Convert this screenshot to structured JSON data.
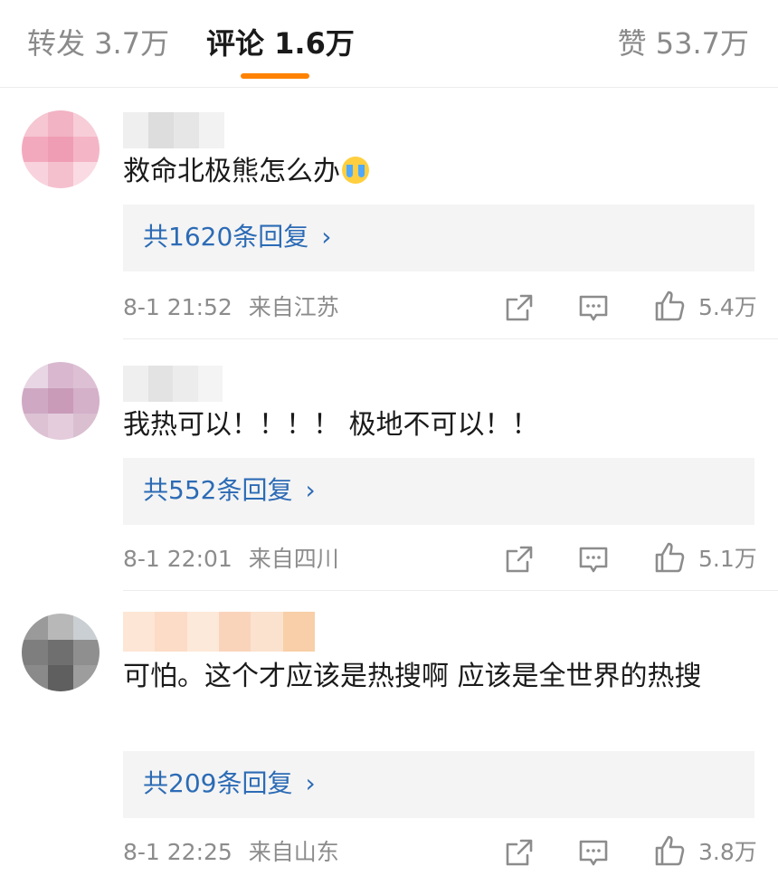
{
  "tabs": {
    "repost": "转发 3.7万",
    "comments": "评论 1.6万",
    "likes": "赞 53.7万"
  },
  "colors": {
    "accent": "#ff8200",
    "link": "#2c6bb5",
    "meta": "#8c8c8c"
  },
  "comments": [
    {
      "text": "救命北极熊怎么办",
      "emoji": "crying-face-icon",
      "replies": "共1620条回复",
      "time": "8-1 21:52",
      "location": "来自江苏",
      "likes": "5.4万"
    },
    {
      "text": "我热可以！！！！ 极地不可以！！",
      "replies": "共552条回复",
      "time": "8-1 22:01",
      "location": "来自四川",
      "likes": "5.1万"
    },
    {
      "text": "可怕。这个才应该是热搜啊 应该是全世界的热搜",
      "replies": "共209条回复",
      "time": "8-1 22:25",
      "location": "来自山东",
      "likes": "3.8万"
    }
  ]
}
